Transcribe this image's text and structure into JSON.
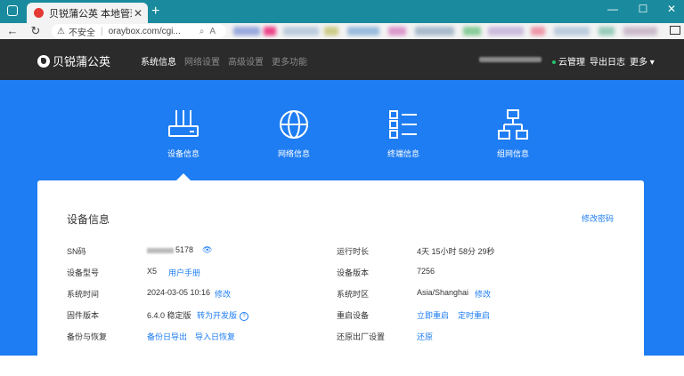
{
  "browser": {
    "tab_title": "贝锐蒲公英 本地管理",
    "url_warning": "不安全",
    "url": "oraybox.com/cgi...",
    "new_tab": "+",
    "minimize": "—",
    "maximize": "☐",
    "close": "✕"
  },
  "app": {
    "brand": "贝锐蒲公英",
    "nav": [
      "系统信息",
      "网络设置",
      "高级设置",
      "更多功能"
    ],
    "cloud_manage": "云管理",
    "export_log": "导出日志",
    "more": "更多"
  },
  "sections": [
    {
      "label": "设备信息",
      "icon": "router-icon"
    },
    {
      "label": "网络信息",
      "icon": "globe-icon"
    },
    {
      "label": "终端信息",
      "icon": "list-icon"
    },
    {
      "label": "组网信息",
      "icon": "network-icon"
    }
  ],
  "device": {
    "title": "设备信息",
    "edit_password": "修改密码",
    "left": [
      {
        "label": "SN码",
        "value": "5178",
        "link": ""
      },
      {
        "label": "设备型号",
        "value": "X5",
        "link": "用户手册"
      },
      {
        "label": "系统时间",
        "value": "2024-03-05 10:16",
        "link": "修改"
      },
      {
        "label": "固件版本",
        "value": "6.4.0 稳定版",
        "link": "转为开发版"
      },
      {
        "label": "备份与恢复",
        "value": "",
        "link": "备份日导出",
        "link2": "导入日恢复"
      }
    ],
    "right": [
      {
        "label": "运行时长",
        "value": "4天 15小时 58分 29秒",
        "link": ""
      },
      {
        "label": "设备版本",
        "value": "7256",
        "link": ""
      },
      {
        "label": "系统时区",
        "value": "Asia/Shanghai",
        "link": "修改"
      },
      {
        "label": "重启设备",
        "value": "",
        "link": "立即重启",
        "link2": "定时重启"
      },
      {
        "label": "还原出厂设置",
        "value": "",
        "link": "还原"
      }
    ]
  },
  "colors": {
    "brand_blue": "#1e7df2",
    "header_dark": "#2b2b2b",
    "chrome_teal": "#1a8b9e"
  }
}
